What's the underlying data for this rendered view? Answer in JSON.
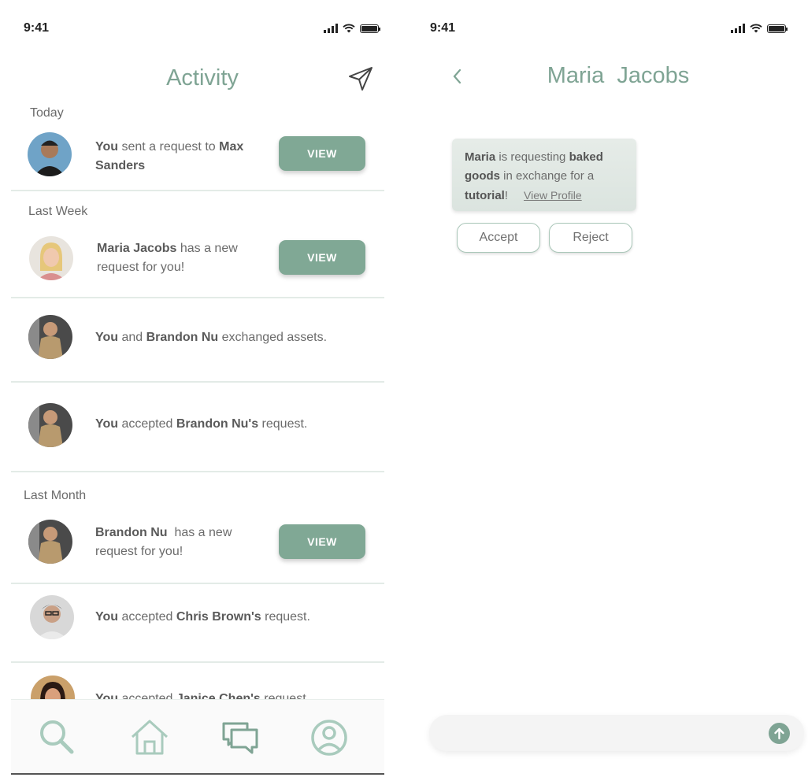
{
  "status_bar": {
    "time": "9:41"
  },
  "colors": {
    "accent": "#7fa494",
    "button": "#80a895",
    "divider": "#e3ebe7",
    "text": "#6b6b6b"
  },
  "activity": {
    "title": "Activity",
    "header_icon": "send-icon",
    "sections": {
      "today": "Today",
      "last_week": "Last Week",
      "last_month": "Last Month"
    },
    "items": [
      {
        "parts": [
          {
            "b": "You"
          },
          {
            "t": " sent a request to "
          },
          {
            "b": "Max Sanders"
          }
        ],
        "button": "VIEW"
      },
      {
        "parts": [
          {
            "b": "Maria Jacobs"
          },
          {
            "t": " has a new request for you!"
          }
        ],
        "button": "VIEW"
      },
      {
        "parts": [
          {
            "b": "You"
          },
          {
            "t": " and "
          },
          {
            "b": "Brandon Nu"
          },
          {
            "t": " exchanged assets."
          }
        ]
      },
      {
        "parts": [
          {
            "b": "You"
          },
          {
            "t": " accepted "
          },
          {
            "b": "Brandon Nu's"
          },
          {
            "t": " request."
          }
        ]
      },
      {
        "parts": [
          {
            "b": "Brandon Nu"
          },
          {
            "t": "  has a new request for you!"
          }
        ],
        "button": "VIEW"
      },
      {
        "parts": [
          {
            "b": "You"
          },
          {
            "t": " accepted "
          },
          {
            "b": "Chris Brown's"
          },
          {
            "t": " request."
          }
        ]
      },
      {
        "parts": [
          {
            "b": "You"
          },
          {
            "t": " accepted "
          },
          {
            "b": "Janice Chen's"
          },
          {
            "t": " request."
          }
        ]
      }
    ],
    "nav": [
      "search-icon",
      "home-icon",
      "chat-icon",
      "profile-icon"
    ]
  },
  "conversation": {
    "back_icon": "chevron-left-icon",
    "title": "Maria  Jacobs",
    "request": {
      "parts": [
        {
          "b": "Maria"
        },
        {
          "t": " is requesting "
        },
        {
          "b": "baked goods"
        },
        {
          "t": " in exchange for a "
        },
        {
          "b": "tutorial"
        },
        {
          "t": "!"
        }
      ],
      "link": "View Profile"
    },
    "accept_label": "Accept",
    "reject_label": "Reject",
    "send_icon": "arrow-up-icon"
  }
}
